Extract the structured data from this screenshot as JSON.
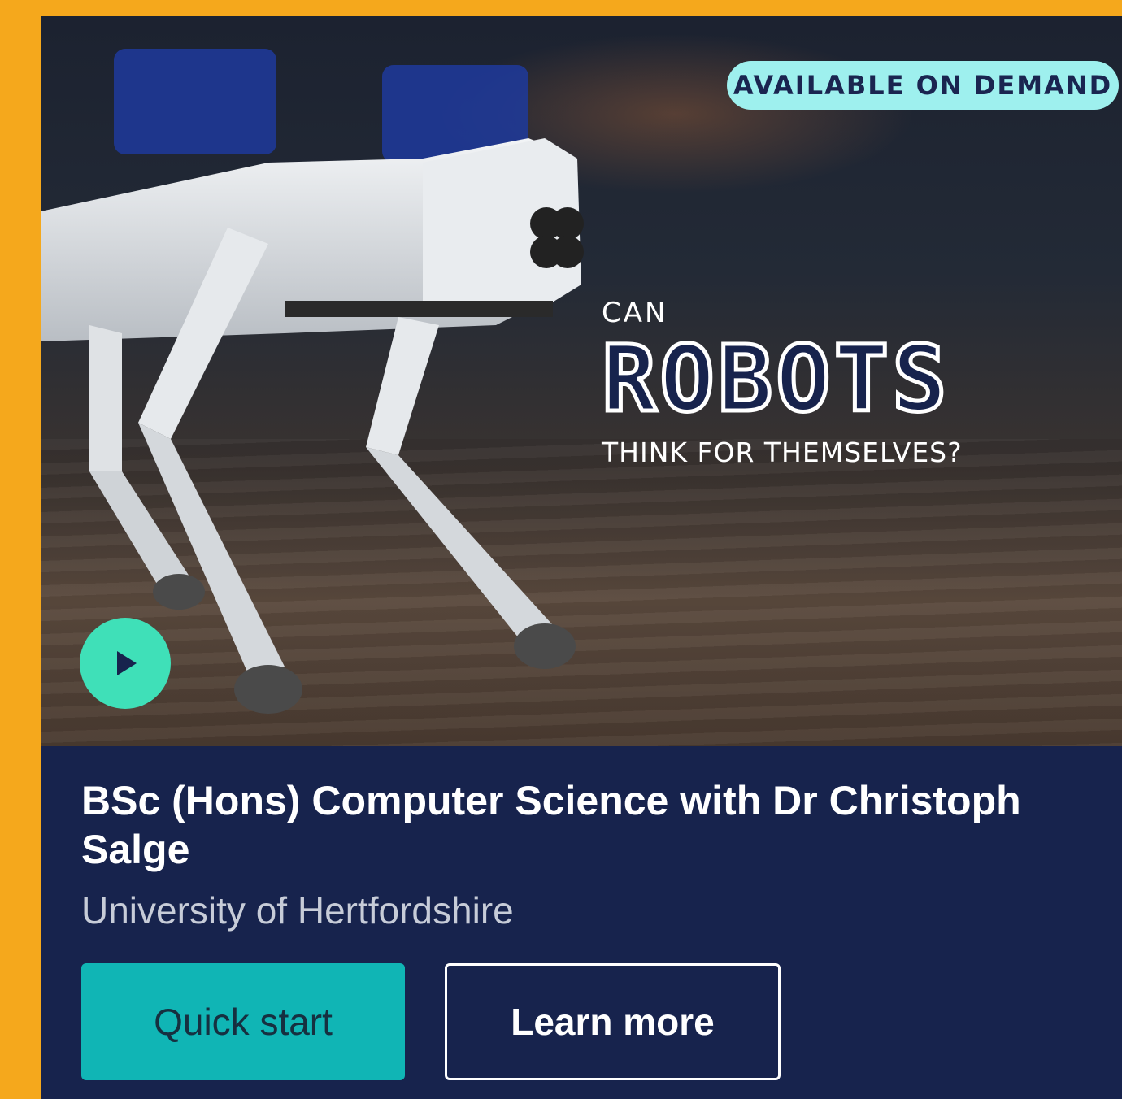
{
  "hero": {
    "badge": "AVAILABLE ON DEMAND",
    "headline": {
      "line1": "CAN",
      "line2": "ROBOTS",
      "line3": "THINK FOR THEMSELVES?"
    },
    "play_icon": "play-icon"
  },
  "course": {
    "title": "BSc (Hons) Computer Science with Dr Christoph Salge",
    "provider": "University of Hertfordshire"
  },
  "actions": {
    "quick_start": "Quick start",
    "learn_more": "Learn more"
  },
  "colors": {
    "page_background": "#f5a81c",
    "card_background": "#17234d",
    "badge_background": "#9ef0ee",
    "play_button": "#3fe0b8",
    "primary_button": "#10b5b5"
  }
}
